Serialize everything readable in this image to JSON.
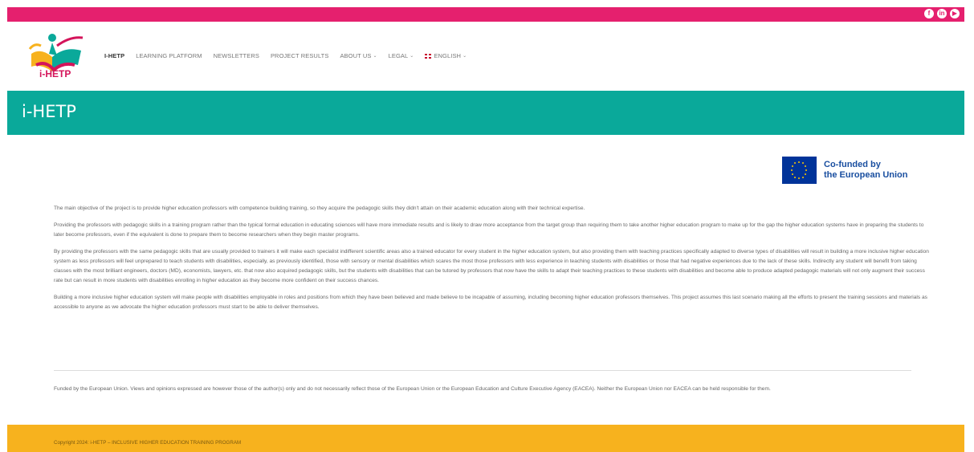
{
  "social": {
    "facebook": "f",
    "linkedin": "in",
    "youtube": "▶"
  },
  "logo": {
    "text": "i-HETP"
  },
  "nav": [
    {
      "label": "I-HETP",
      "active": true,
      "dropdown": false
    },
    {
      "label": "LEARNING PLATFORM",
      "active": false,
      "dropdown": false
    },
    {
      "label": "NEWSLETTERS",
      "active": false,
      "dropdown": false
    },
    {
      "label": "PROJECT RESULTS",
      "active": false,
      "dropdown": false
    },
    {
      "label": "ABOUT US",
      "active": false,
      "dropdown": true
    },
    {
      "label": "LEGAL",
      "active": false,
      "dropdown": true
    },
    {
      "label": "ENGLISH",
      "active": false,
      "dropdown": true
    }
  ],
  "page_title": "i-HETP",
  "eu_badge": {
    "line1": "Co-funded by",
    "line2": "the European Union"
  },
  "paragraphs": [
    "The main objective of the project is to provide higher education professors with competence building training, so they acquire the pedagogic skills they didn't attain on their academic education along with their technical expertise.",
    "Providing the professors with pedagogic skills in a training program rather than the typical formal education in educating sciences will have more immediate results and is likely to draw more acceptance from the target group than requiring them to take another higher education program to make up for the gap the higher education systems have in preparing the students to later become professors, even if the equivalent is done to prepare them to become researchers when they begin master programs.",
    "By providing the professors with the same pedagogic skills that are usually provided to trainers it will make each specialist indifferent scientific areas also a trained educator for every student in the higher education system, but also providing them with teaching practices specifically adapted to diverse types of disabilities will result in building a more inclusive higher education system as less professors will feel unprepared to teach students with disabilities, especially, as previously identified, those with sensory or mental disabilities which scares the most those professors with less experience in teaching students with disabilities or those that had negative experiences due to the lack of these skills. Indirectly any student will benefit from taking classes with the most brilliant engineers, doctors (MD), economists, lawyers, etc. that now also acquired pedagogic skills, but the students with disabilities that can be tutored by professors that now have the skills to adapt their teaching practices to these students with disabilities and become able to produce adapted pedagogic materials will not only augment their success rate but can result in more students with disabilities enrolling in higher education as they become more confident on their success chances.",
    "Building a more inclusive higher education system will make people with disabilities employable in roles and positions from which they have been believed and made believe to be incapable of assuming, including becoming higher education professors themselves. This project assumes this last scenario making all the efforts to present the training sessions and materials as accessible to anyone as we advocate the higher education professors must start to be able to deliver themselves."
  ],
  "disclaimer": "Funded by the European Union. Views and opinions expressed are however those of the author(s) only and do not necessarily reflect those of the European Union or the European Education and Culture Executive Agency (EACEA). Neither the European Union nor EACEA can be held responsible for them.",
  "footer": {
    "copyright": "Copyright 2024: i-HETP – INCLUSIVE HIGHER EDUCATION TRAINING PROGRAM"
  },
  "colors": {
    "topbar": "#e5206e",
    "title_band": "#0aa99a",
    "footer": "#f7b21e",
    "eu_blue": "#003399",
    "eu_star": "#ffcc00"
  }
}
